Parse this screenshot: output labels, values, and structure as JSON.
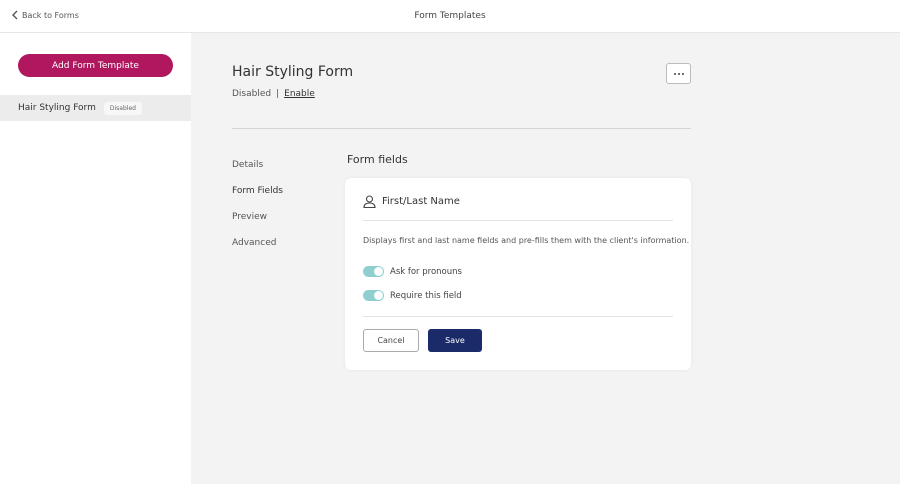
{
  "header": {
    "back_label": "Back to Forms",
    "title": "Form Templates"
  },
  "sidebar": {
    "add_button_label": "Add Form Template",
    "items": [
      {
        "label": "Hair Styling Form",
        "badge": "Disabled"
      }
    ]
  },
  "main": {
    "form_title": "Hair Styling Form",
    "status": {
      "current": "Disabled",
      "separator": "|",
      "action": "Enable"
    },
    "more_icon": "ellipsis-icon",
    "subnav": [
      "Details",
      "Form Fields",
      "Preview",
      "Advanced"
    ],
    "active_subnav": "Form Fields",
    "section_title": "Form fields",
    "field_card": {
      "icon": "person-icon",
      "field_name": "First/Last Name",
      "description": "Displays first and last name fields and pre-fills them with the client's information.",
      "toggles": [
        {
          "label": "Ask for pronouns",
          "on": true
        },
        {
          "label": "Require this field",
          "on": true
        }
      ],
      "toggle_color": "#8fcfcf",
      "cancel_label": "Cancel",
      "save_label": "Save"
    }
  },
  "colors": {
    "accent": "#b0175f",
    "primary": "#1b2a68"
  }
}
